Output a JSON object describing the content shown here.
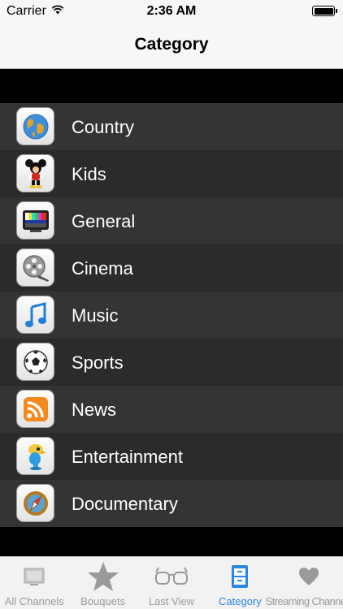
{
  "status_bar": {
    "carrier": "Carrier",
    "time": "2:36 AM"
  },
  "nav": {
    "title": "Category"
  },
  "categories": [
    {
      "label": "Country",
      "icon": "globe-icon"
    },
    {
      "label": "Kids",
      "icon": "cartoon-mouse-icon"
    },
    {
      "label": "General",
      "icon": "tv-test-pattern-icon"
    },
    {
      "label": "Cinema",
      "icon": "film-reel-icon"
    },
    {
      "label": "Music",
      "icon": "music-note-icon"
    },
    {
      "label": "Sports",
      "icon": "soccer-ball-icon"
    },
    {
      "label": "News",
      "icon": "rss-feed-icon"
    },
    {
      "label": "Entertainment",
      "icon": "bird-character-icon"
    },
    {
      "label": "Documentary",
      "icon": "compass-icon"
    }
  ],
  "tabs": [
    {
      "label": "All Channels",
      "icon": "tv-icon",
      "active": false
    },
    {
      "label": "Bouquets",
      "icon": "star-icon",
      "active": false
    },
    {
      "label": "Last View",
      "icon": "glasses-icon",
      "active": false
    },
    {
      "label": "Category",
      "icon": "file-cabinet-icon",
      "active": true
    },
    {
      "label": "Streaming Channel l",
      "icon": "heart-icon",
      "active": false
    }
  ],
  "colors": {
    "active_tab": "#2b86e0",
    "inactive_tab": "#9a9a9a",
    "row_dark": "#2b2b2b",
    "row_light": "#343434"
  }
}
